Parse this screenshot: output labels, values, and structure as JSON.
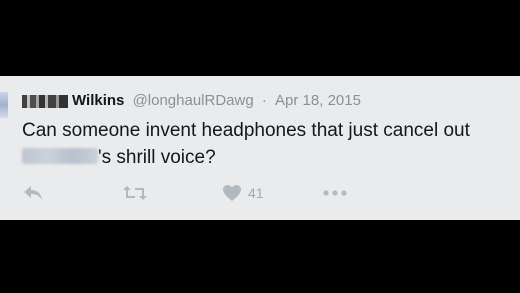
{
  "tweet": {
    "display_name_suffix": "Wilkins",
    "handle": "@longhaulRDawg",
    "separator": "·",
    "date": "Apr 18, 2015",
    "text_line1": "Can someone invent headphones that just cancel out",
    "text_line2_suffix": "'s shrill voice?"
  },
  "actions": {
    "like_count": "41"
  },
  "colors": {
    "card_bg": "#e9ebed",
    "text": "#14171a",
    "muted": "#8a9099",
    "icon": "#b3b9c1"
  }
}
